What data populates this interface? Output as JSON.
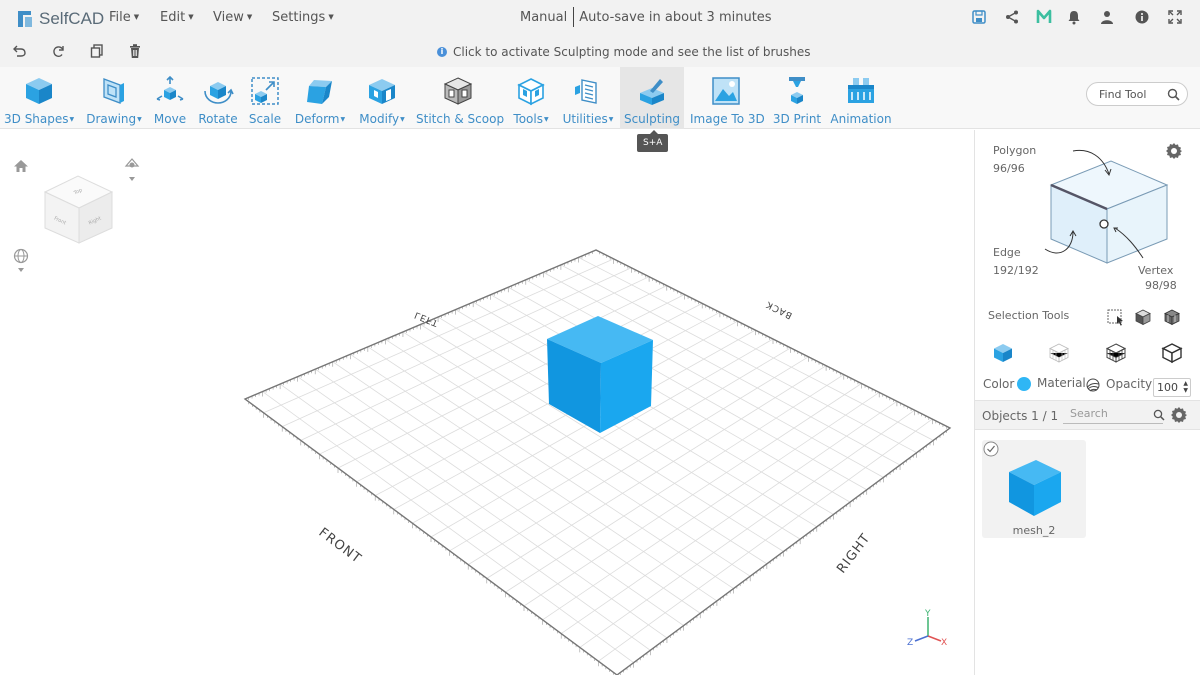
{
  "app": {
    "name": "SelfCAD",
    "accent_color": "#3f8ec7",
    "object_color": "#1aa3ea"
  },
  "menubar": {
    "items": [
      {
        "label": "File"
      },
      {
        "label": "Edit"
      },
      {
        "label": "View"
      },
      {
        "label": "Settings"
      }
    ],
    "mode": "Manual",
    "autosave": "Auto-save in about 3 minutes",
    "right_icons": [
      "save-icon",
      "share-icon",
      "m-icon",
      "bell-icon",
      "user-icon",
      "info-icon",
      "fullscreen-icon"
    ]
  },
  "subbar": {
    "hint": "Click to activate Sculpting mode and see the list of brushes",
    "icons": [
      "undo-icon",
      "redo-icon",
      "copy-icon",
      "delete-icon"
    ]
  },
  "toolbar": {
    "tools": [
      {
        "label": "3D Shapes",
        "dropdown": true
      },
      {
        "label": "Drawing",
        "dropdown": true
      },
      {
        "label": "Move",
        "dropdown": false
      },
      {
        "label": "Rotate",
        "dropdown": false
      },
      {
        "label": "Scale",
        "dropdown": false
      },
      {
        "label": "Deform",
        "dropdown": true
      },
      {
        "label": "Modify",
        "dropdown": true
      },
      {
        "label": "Stitch & Scoop",
        "dropdown": false
      },
      {
        "label": "Tools",
        "dropdown": true
      },
      {
        "label": "Utilities",
        "dropdown": true
      },
      {
        "label": "Sculpting",
        "dropdown": false,
        "active": true
      },
      {
        "label": "Image To 3D",
        "dropdown": false
      },
      {
        "label": "3D Print",
        "dropdown": false
      },
      {
        "label": "Animation",
        "dropdown": false
      }
    ],
    "tooltip": "S+A",
    "find_tool": "Find Tool"
  },
  "viewport": {
    "grid_labels": {
      "left": "LEFT",
      "back": "BACK",
      "front": "FRONT",
      "right": "RIGHT"
    },
    "view_cube": {
      "top": "Top",
      "front": "Front",
      "right": "Right"
    },
    "axes": {
      "x": "X",
      "y": "Y",
      "z": "Z"
    }
  },
  "panel": {
    "polygon_label": "Polygon",
    "polygon_count": "96/96",
    "edge_label": "Edge",
    "edge_count": "192/192",
    "vertex_label": "Vertex",
    "vertex_count": "98/98",
    "selection_tools": "Selection Tools",
    "color_label": "Color",
    "material_label": "Material",
    "opacity_label": "Opacity",
    "opacity_value": "100",
    "objects_label": "Objects 1 / 1",
    "search_placeholder": "Search",
    "object_name": "mesh_2"
  }
}
